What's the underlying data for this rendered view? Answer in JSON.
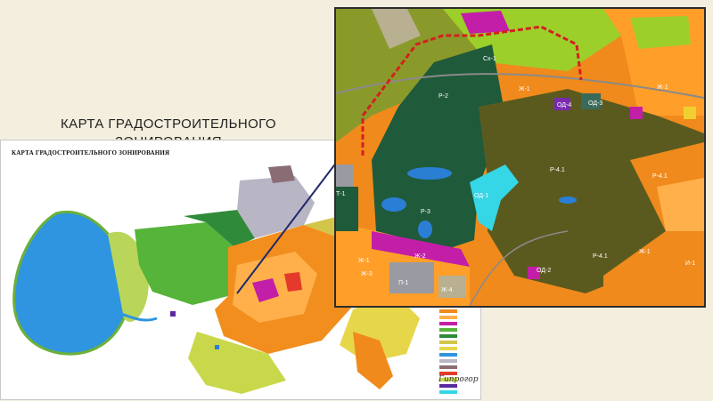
{
  "slide": {
    "title": "КАРТА ГРАДОСТРОИТЕЛЬНОГО ЗОНИРОВАНИЯ"
  },
  "map": {
    "heading": "КАРТА ГРАДОСТРОИТЕЛЬНОГО ЗОНИРОВАНИЯ",
    "signature": "Гипрогор",
    "legend_items": 18
  },
  "inset": {
    "zone_labels": [
      "Р-2",
      "Р-3",
      "Р-4.1",
      "Р-4.1",
      "Р-4.1",
      "Ж-1",
      "Ж-1",
      "Ж-1",
      "Ж-1",
      "Ж-2",
      "Ж-3",
      "ОД-1",
      "ОД-2",
      "ОД-3",
      "ОД-4",
      "П-1",
      "Сх-1",
      "Т-1",
      "Ж-4",
      "И-1"
    ],
    "colors": {
      "residential_orange": "#f08a1c",
      "residential_bright": "#ff9f2a",
      "forest_dark_green": "#1f5a3b",
      "olive_recreation": "#5a5a1f",
      "water_blue": "#2a7fd4",
      "public_magenta": "#c21ea8",
      "cyan_zone": "#35d6e6",
      "yellow_green": "#9ccf2a",
      "grey_industrial": "#9a9aa2",
      "red_boundary": "#d42020"
    }
  }
}
